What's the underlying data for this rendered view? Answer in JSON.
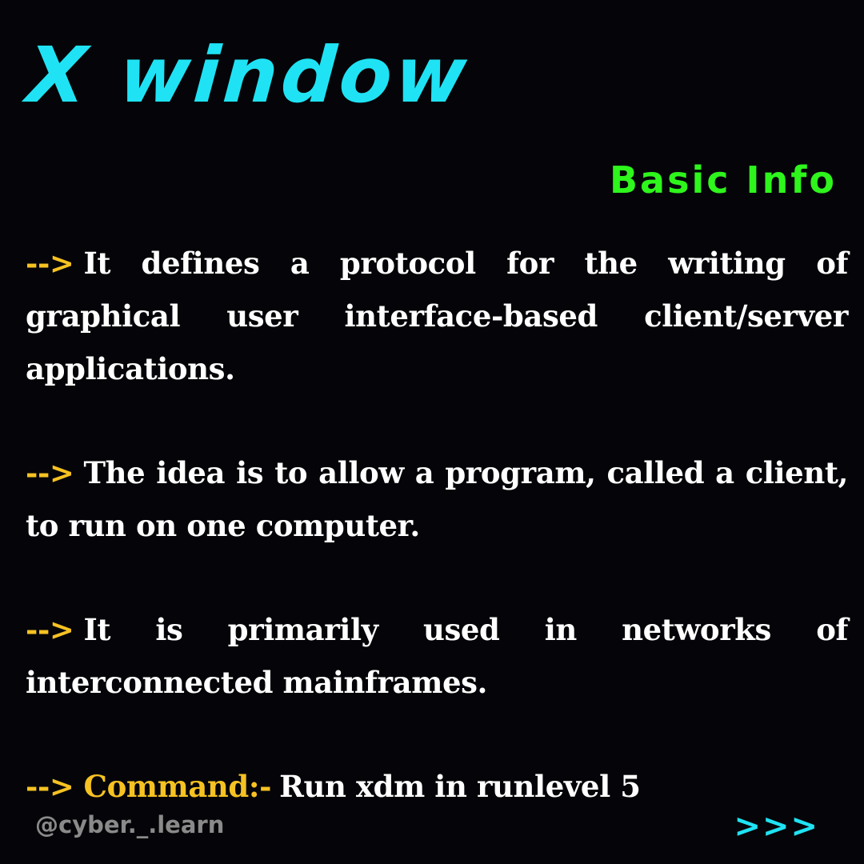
{
  "header": {
    "title": "X window",
    "subtitle": "Basic Info"
  },
  "arrow": "-->",
  "points": [
    {
      "text": "It defines a protocol for the writing of graphical user interface-based client/server applications."
    },
    {
      "text": "The idea is to allow a program, called a client, to run on one computer."
    },
    {
      "text": "It is primarily used in networks of interconnected mainframes."
    }
  ],
  "command": {
    "label": "Command:-",
    "text": "Run xdm in runlevel 5"
  },
  "footer": {
    "handle": "@cyber._.learn",
    "next": ">>>"
  },
  "colors": {
    "background": "#050509",
    "title": "#1fe3f4",
    "subtitle": "#2ef51c",
    "accent": "#f6c222",
    "body_text": "#ffffff",
    "handle": "#8a8a8a"
  }
}
